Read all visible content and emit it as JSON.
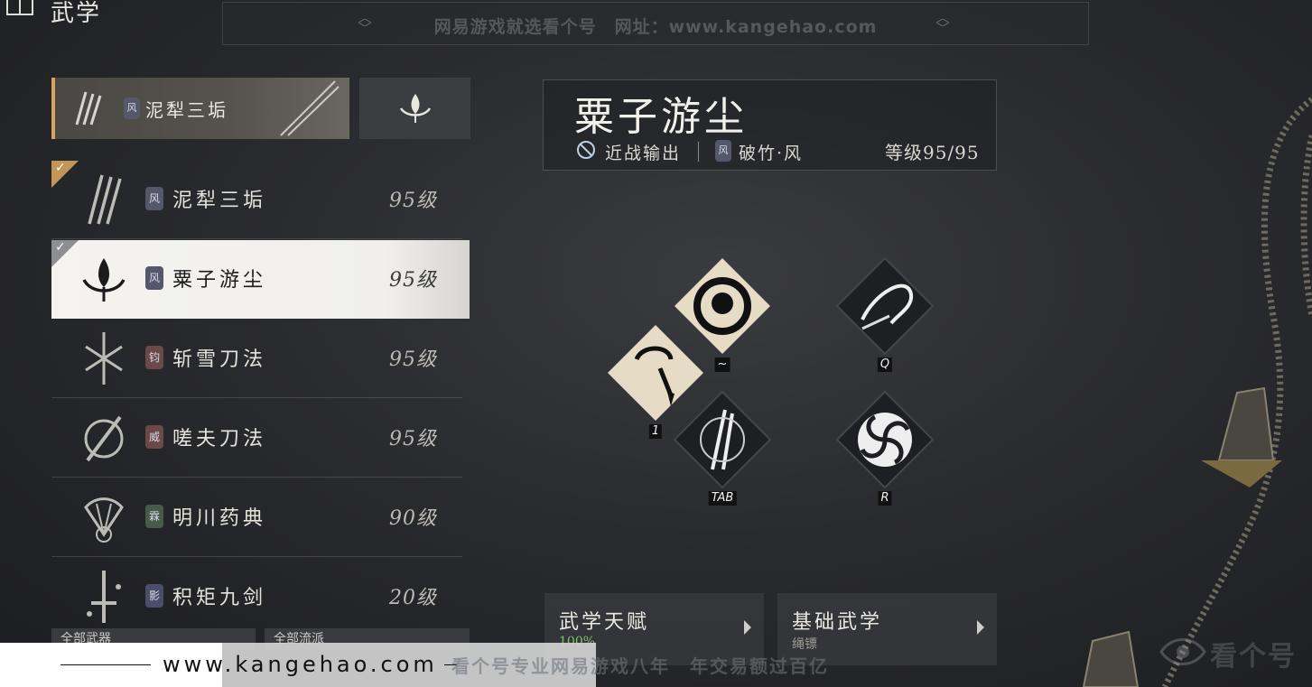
{
  "header": {
    "title": "武学",
    "book_icon": "book-icon"
  },
  "banner": {
    "text": "网易游戏就选看个号　网址：www.kangehao.com"
  },
  "equipped": {
    "main_label": "泥犁三垢",
    "main_badge": "风",
    "secondary_icon": "lotus-blade-icon"
  },
  "list": [
    {
      "name": "泥犁三垢",
      "level": "95级",
      "badge": "风",
      "badge_color": "#55576a",
      "checked": true,
      "selected": false
    },
    {
      "name": "粟子游尘",
      "level": "95级",
      "badge": "风",
      "badge_color": "#55576a",
      "checked": true,
      "selected": true
    },
    {
      "name": "斩雪刀法",
      "level": "95级",
      "badge": "钧",
      "badge_color": "#6a4a48",
      "checked": false,
      "selected": false
    },
    {
      "name": "嗟夫刀法",
      "level": "95级",
      "badge": "威",
      "badge_color": "#6a4a48",
      "checked": false,
      "selected": false
    },
    {
      "name": "明川药典",
      "level": "90级",
      "badge": "霖",
      "badge_color": "#485a48",
      "checked": false,
      "selected": false
    },
    {
      "name": "积矩九剑",
      "level": "20级",
      "badge": "影",
      "badge_color": "#4a4e68",
      "checked": false,
      "selected": false
    }
  ],
  "filters": {
    "left": "全部武器",
    "right": "全部流派"
  },
  "detail": {
    "title": "粟子游尘",
    "role": "近战输出",
    "style_badge": "风",
    "style": "破竹·风",
    "level": "等级95/95"
  },
  "skills": [
    {
      "key": "~",
      "icon": "ink-circle-icon"
    },
    {
      "key": "1",
      "icon": "rope-dart-icon"
    },
    {
      "key": "TAB",
      "icon": "dual-blade-icon"
    },
    {
      "key": "Q",
      "icon": "whip-strike-icon"
    },
    {
      "key": "R",
      "icon": "vortex-icon"
    }
  ],
  "cards": [
    {
      "title": "武学天赋",
      "sub": "100%"
    },
    {
      "title": "基础武学",
      "sub": "绳镖"
    }
  ],
  "footer": {
    "url": "www.kangehao.com",
    "slogan": "看个号专业网易游戏八年　年交易额过百亿",
    "logo_text": "看个号"
  },
  "colors": {
    "accent": "#d6a45a",
    "selected_bg": "#f4f3f0",
    "progress_green": "#7fbf6a"
  }
}
